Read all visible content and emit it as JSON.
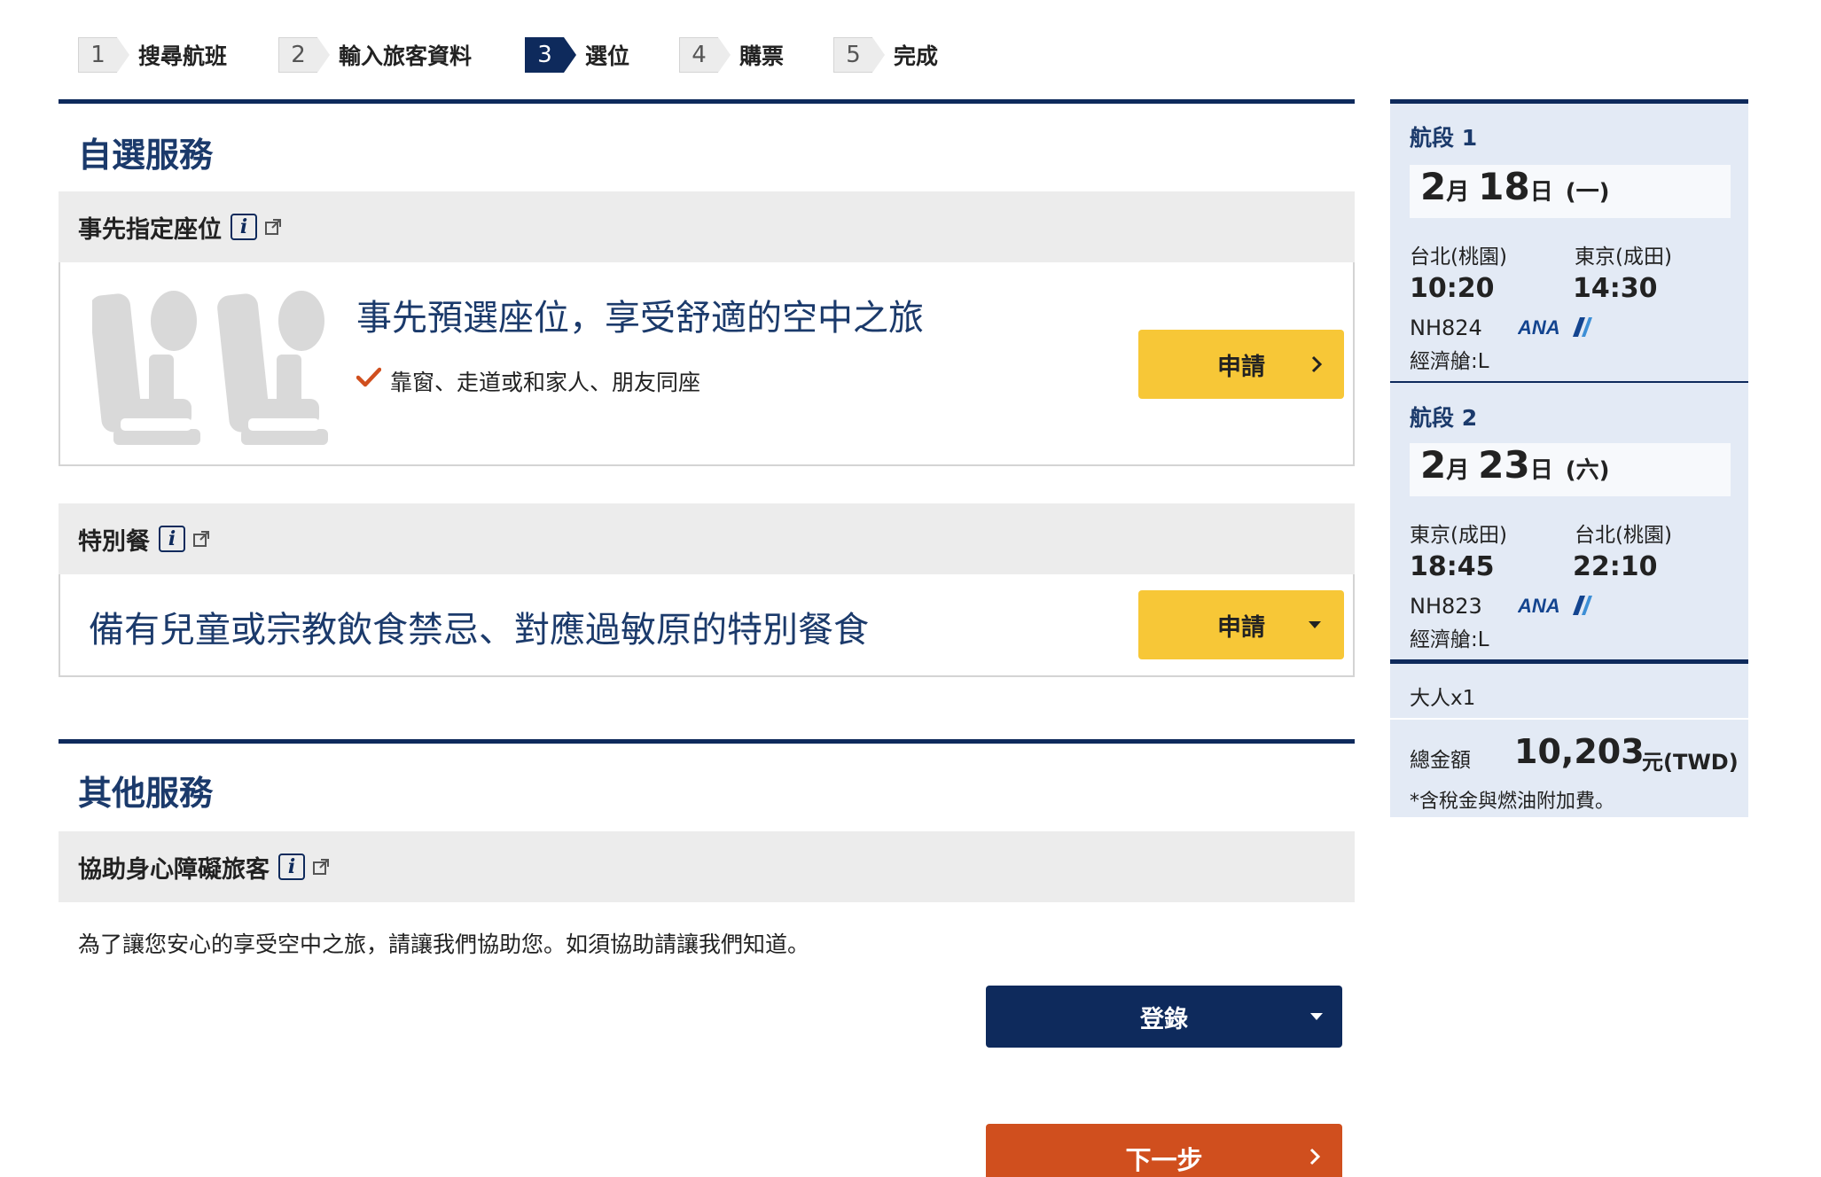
{
  "steps": [
    {
      "num": "1",
      "label": "搜尋航班"
    },
    {
      "num": "2",
      "label": "輸入旅客資料"
    },
    {
      "num": "3",
      "label": "選位",
      "active": true
    },
    {
      "num": "4",
      "label": "購票"
    },
    {
      "num": "5",
      "label": "完成"
    }
  ],
  "optional": {
    "title": "自選服務",
    "seat": {
      "header": "事先指定座位",
      "headline": "事先預選座位，享受舒適的空中之旅",
      "bullet": "靠窗、走道或和家人、朋友同座",
      "button": "申請"
    },
    "meal": {
      "header": "特別餐",
      "headline": "備有兒童或宗教飲食禁忌、對應過敏原的特別餐食",
      "button": "申請"
    }
  },
  "other": {
    "title": "其他服務",
    "assist": {
      "header": "協助身心障礙旅客",
      "text": "為了讓您安心的享受空中之旅，請讓我們協助您。如須協助請讓我們知道。",
      "button": "登錄"
    },
    "next_button": "下一步"
  },
  "itinerary": {
    "segments": [
      {
        "title": "航段 1",
        "month": "2",
        "day": "18",
        "weekday": "(一)",
        "month_unit": "月",
        "day_unit": "日",
        "from_city": "台北(桃園)",
        "to_city": "東京(成田)",
        "dep": "10:20",
        "arr": "14:30",
        "flight": "NH824",
        "airline_logo": "ANA",
        "cabin": "經濟艙:L"
      },
      {
        "title": "航段 2",
        "month": "2",
        "day": "23",
        "weekday": "(六)",
        "month_unit": "月",
        "day_unit": "日",
        "from_city": "東京(成田)",
        "to_city": "台北(桃園)",
        "dep": "18:45",
        "arr": "22:10",
        "flight": "NH823",
        "airline_logo": "ANA",
        "cabin": "經濟艙:L"
      }
    ],
    "passengers": "大人x1",
    "total_label": "總金額",
    "total_amount": "10,203",
    "total_unit": "元(TWD)",
    "note": "*含稅金與燃油附加費。"
  },
  "colors": {
    "navy": "#0e2a5c",
    "yellow": "#f7c737",
    "orange": "#d04f1e",
    "side_bg": "#e3eaf5"
  }
}
